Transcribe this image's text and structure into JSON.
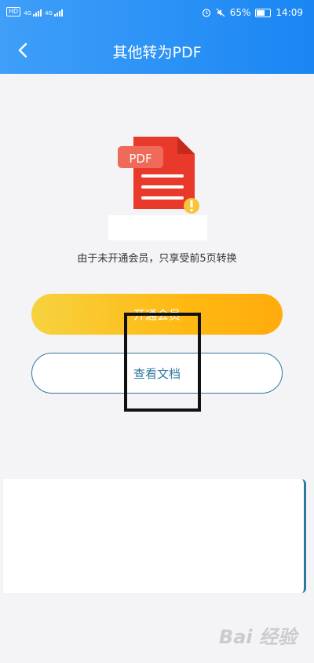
{
  "status_bar": {
    "hd_badge": "HD",
    "signal_1": "4G",
    "signal_2": "4G",
    "battery": "65%",
    "time": "14:09"
  },
  "header": {
    "title": "其他转为PDF"
  },
  "document": {
    "badge_text": "PDF"
  },
  "notice": "由于未开通会员，只享受前5页转换",
  "buttons": {
    "open_vip": "开通会员",
    "view_doc": "查看文档"
  },
  "watermark": "Bai 经验",
  "colors": {
    "header_blue": "#1a86f3",
    "doc_red": "#e8392b",
    "badge_red": "#f06a5a",
    "vip_gold": "#ffb913",
    "outline_blue": "#2f79a0"
  }
}
